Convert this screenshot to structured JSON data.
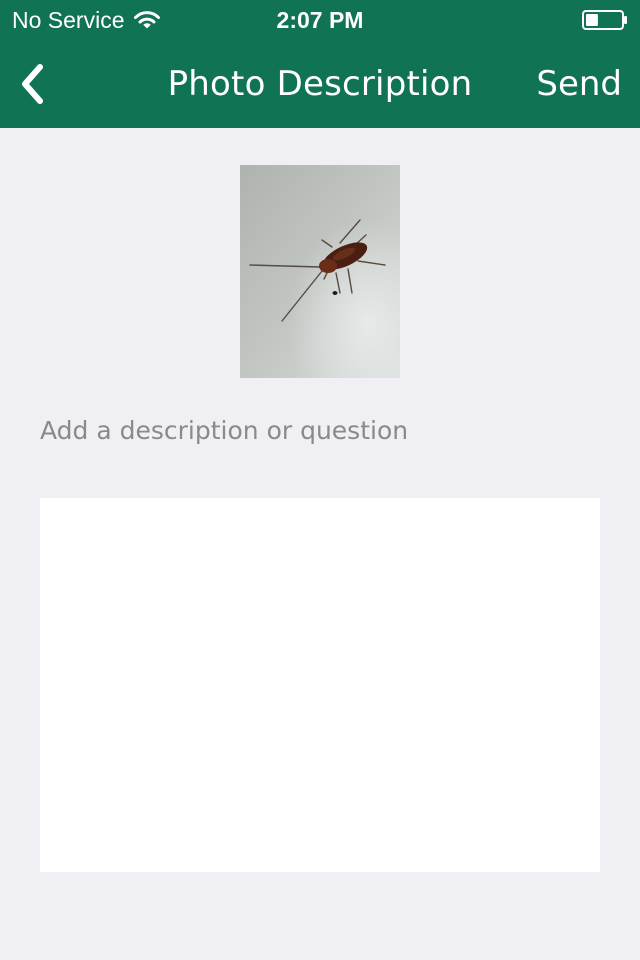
{
  "status_bar": {
    "carrier": "No Service",
    "time": "2:07 PM",
    "battery_level": 0.35
  },
  "nav": {
    "title": "Photo Description",
    "send_label": "Send"
  },
  "form": {
    "prompt_label": "Add a description or question",
    "description_value": ""
  },
  "icons": {
    "back": "chevron-left-icon",
    "wifi": "wifi-icon",
    "battery": "battery-icon"
  },
  "colors": {
    "header_bg": "#107355",
    "page_bg": "#efeff4",
    "label_gray": "#8a8a8a"
  }
}
